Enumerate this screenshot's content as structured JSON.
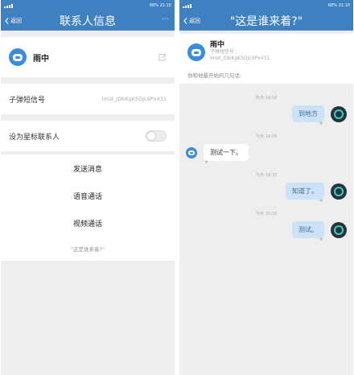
{
  "status_bar": {
    "left_text": "中国移动",
    "right_text": "68% 21:10"
  },
  "left": {
    "back_label": "返回",
    "title": "联系人信息",
    "more_icon": "more-dots-icon",
    "contact": {
      "name": "雨中",
      "edit_icon": "edit-icon"
    },
    "sms_row": {
      "label": "子弹短信号",
      "value": "lmid_/DbKgK5DJL9Px431"
    },
    "star_row": {
      "label": "设为星标联系人",
      "toggle_on": false
    },
    "actions": [
      "发送消息",
      "语音通话",
      "视频通话"
    ],
    "footer_note": "\"这是谁来着?\""
  },
  "right": {
    "back_label": "返回",
    "title": "\"这是谁来着?\"",
    "header": {
      "name": "雨中",
      "sub1": "子弹短信号：",
      "sub2": "lmid_/DbKgK5DJL9Px431"
    },
    "intro": "你和他最开始的几句话:",
    "messages": [
      {
        "time": "昨天 14:34",
        "dir": "out",
        "text": "到地方"
      },
      {
        "time": "今天 14:09",
        "dir": "in",
        "text": "测试一下。"
      },
      {
        "time": "今天 14:10",
        "dir": "out",
        "text": "知道了。"
      },
      {
        "time": "今天 15:18",
        "dir": "out",
        "text": "测试。"
      }
    ]
  },
  "colors": {
    "primary": "#3f80c1",
    "avatar": "#3a8dde",
    "bubble_out": "#cde2f6",
    "background": "#eeeeee"
  }
}
